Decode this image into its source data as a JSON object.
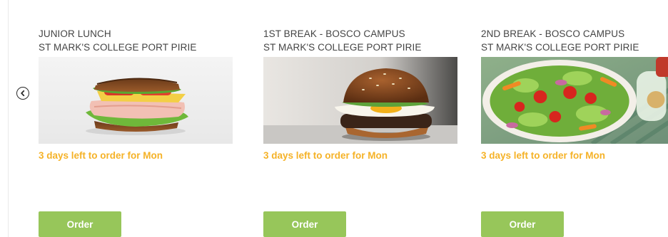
{
  "carousel": {
    "prev_icon": "chevron-left-circle-icon",
    "cards": [
      {
        "title_line1": "JUNIOR LUNCH",
        "title_line2": "ST MARK'S COLLEGE PORT PIRIE",
        "image": "sandwich",
        "deadline": "3 days left to order for Mon",
        "order_label": "Order"
      },
      {
        "title_line1": "1ST BREAK - BOSCO CAMPUS",
        "title_line2": "ST MARK'S COLLEGE PORT PIRIE",
        "image": "burger",
        "deadline": "3 days left to order for Mon",
        "order_label": "Order"
      },
      {
        "title_line1": "2ND BREAK - BOSCO CAMPUS",
        "title_line2": "ST MARK'S COLLEGE PORT PIRIE",
        "image": "salad",
        "deadline": "3 days left to order for Mon",
        "order_label": "Order"
      }
    ]
  },
  "colors": {
    "deadline": "#f5b227",
    "order_button": "#97c65a",
    "title_text": "#444444"
  }
}
